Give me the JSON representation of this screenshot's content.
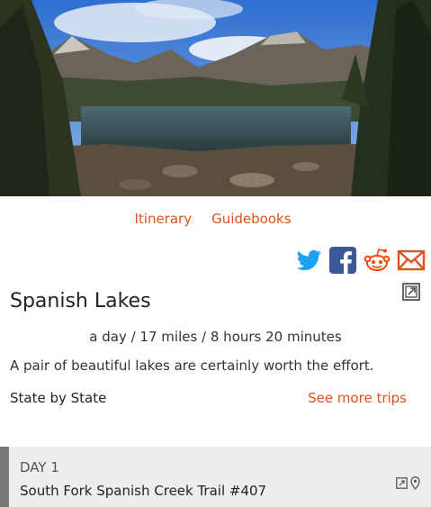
{
  "nav": {
    "itinerary": "Itinerary",
    "guidebooks": "Guidebooks"
  },
  "share": {
    "icons": [
      "twitter-icon",
      "facebook-icon",
      "reddit-icon",
      "email-icon"
    ],
    "colors": {
      "twitter": "#1da1f2",
      "facebook": "#3b5998",
      "reddit": "#ff4500",
      "email": "#e0511c"
    }
  },
  "trip": {
    "title": "Spanish Lakes",
    "stats": "a day / 17 miles / 8 hours 20 minutes",
    "description": "A pair of beautiful lakes are certainly worth the effort.",
    "category": "State by State",
    "more_link": "See more trips"
  },
  "day": {
    "label": "DAY 1",
    "trail": "South Fork Spanish Creek Trail #407"
  },
  "colors": {
    "accent": "#e0511c",
    "day_bar": "#777777",
    "day_bg": "#eeeeee"
  }
}
